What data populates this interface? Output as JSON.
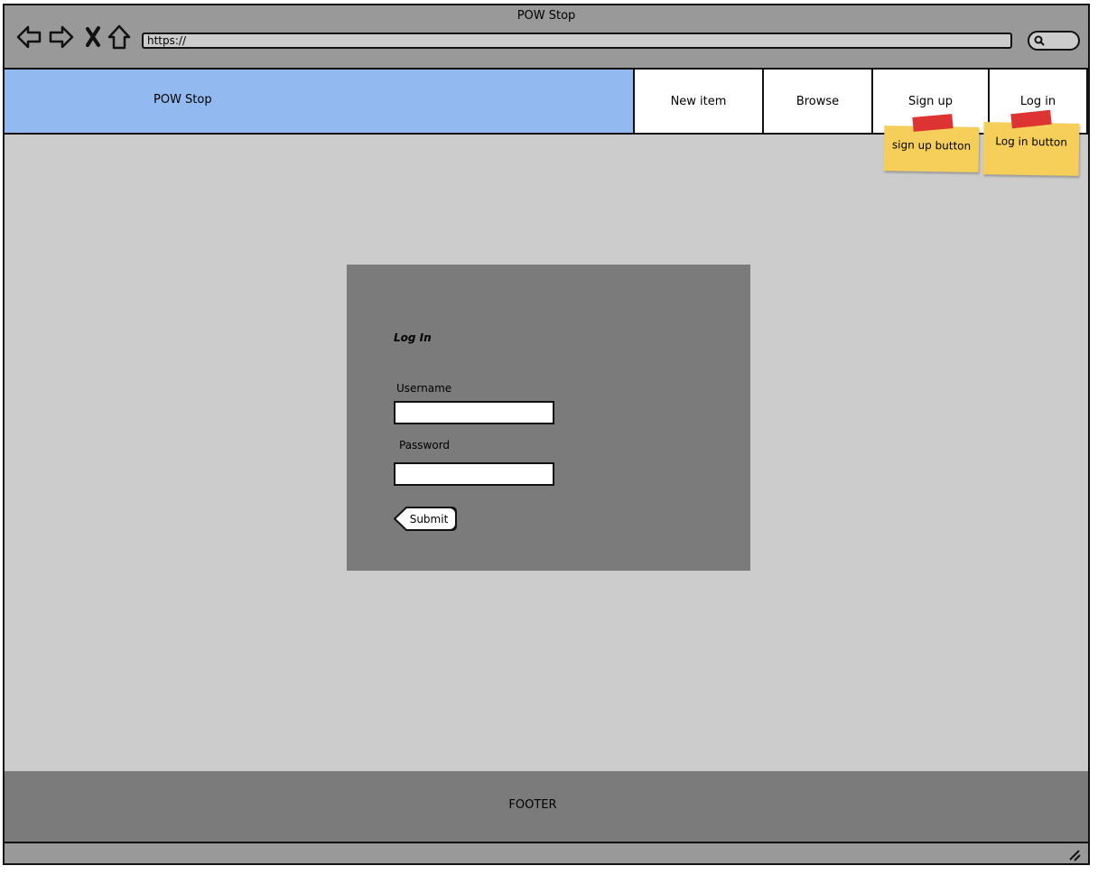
{
  "window": {
    "title": "POW Stop"
  },
  "browser": {
    "url": "https://"
  },
  "header": {
    "brand": "POW Stop",
    "nav": [
      {
        "label": "New item"
      },
      {
        "label": "Browse"
      },
      {
        "label": "Sign up"
      },
      {
        "label": "Log in"
      }
    ]
  },
  "notes": [
    {
      "text": "sign up button"
    },
    {
      "text": "Log in button"
    }
  ],
  "login": {
    "title": "Log In",
    "username_label": "Username",
    "username_value": "",
    "password_label": "Password",
    "password_value": "",
    "submit_label": "Submit"
  },
  "footer": {
    "text": "FOOTER"
  },
  "colors": {
    "brand_bg": "#93b9f1",
    "frame_gray": "#999999",
    "content_bg": "#cccccc",
    "panel_bg": "#7b7b7b",
    "sticky": "#f5cf5a",
    "tape": "#dd3333"
  }
}
